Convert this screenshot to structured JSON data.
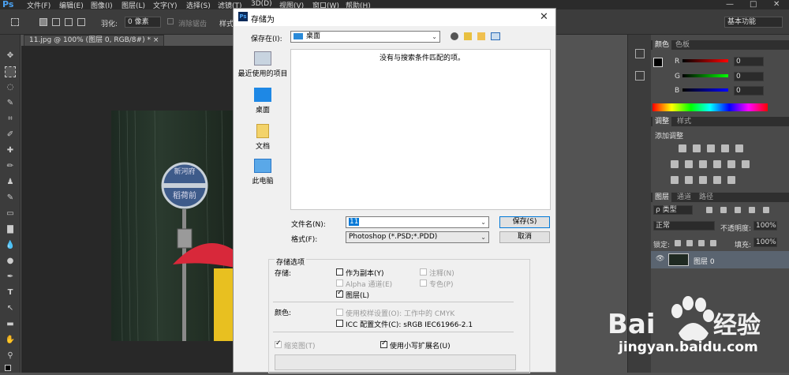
{
  "app": {
    "logo": "Ps"
  },
  "menubar": {
    "items": [
      "文件(F)",
      "编辑(E)",
      "图像(I)",
      "图层(L)",
      "文字(Y)",
      "选择(S)",
      "滤镜(T)",
      "3D(D)",
      "视图(V)",
      "窗口(W)",
      "帮助(H)"
    ]
  },
  "window_controls": [
    "—",
    "□",
    "✕"
  ],
  "options_bar": {
    "feather_label": "羽化:",
    "feather_value": "0 像素",
    "antialias_label": "消除锯齿",
    "style_label": "样式",
    "workspace": "基本功能"
  },
  "document": {
    "tab_title": "11.jpg @ 100% (图层 0, RGB/8#) *",
    "tab_close": "×"
  },
  "image_sign": {
    "line1": "新河府",
    "line2": "稻荷前"
  },
  "color_panel": {
    "tabs": [
      "颜色",
      "色板"
    ],
    "channels": [
      {
        "label": "R",
        "value": "0",
        "color": "#e02020"
      },
      {
        "label": "G",
        "value": "0",
        "color": "#20b020"
      },
      {
        "label": "B",
        "value": "0",
        "color": "#3030e0"
      }
    ]
  },
  "adjust_panel": {
    "tabs": [
      "调整",
      "样式"
    ],
    "add_label": "添加调整"
  },
  "layers_panel": {
    "tabs": [
      "图层",
      "通道",
      "路径"
    ],
    "filter_label": "ρ 类型",
    "blend_mode": "正常",
    "opacity_label": "不透明度:",
    "opacity_value": "100%",
    "lock_label": "锁定:",
    "fill_label": "填充:",
    "fill_value": "100%",
    "layer_name": "图层 0"
  },
  "dialog": {
    "title": "存储为",
    "close": "✕",
    "save_in_label": "保存在(I):",
    "save_in_value": "桌面",
    "empty_message": "没有与搜索条件匹配的项。",
    "places": [
      "最近使用的项目",
      "桌面",
      "文档",
      "此电脑"
    ],
    "filename_label": "文件名(N):",
    "filename_value": "11",
    "format_label": "格式(F):",
    "format_value": "Photoshop (*.PSD;*.PDD)",
    "save_button": "保存(S)",
    "cancel_button": "取消",
    "options_title": "存储选项",
    "storage_label": "存储:",
    "as_copy": "作为副本(Y)",
    "notes": "注释(N)",
    "alpha": "Alpha 通道(E)",
    "spot": "专色(P)",
    "layers": "图层(L)",
    "color_label": "颜色:",
    "proof": "使用校样设置(O):  工作中的 CMYK",
    "icc": "ICC 配置文件(C):  sRGB IEC61966-2.1",
    "thumbnail": "缩览图(T)",
    "lowercase_ext": "使用小写扩展名(U)"
  },
  "watermark": {
    "brand": "Bai du 经验",
    "url": "jingyan.baidu.com"
  }
}
